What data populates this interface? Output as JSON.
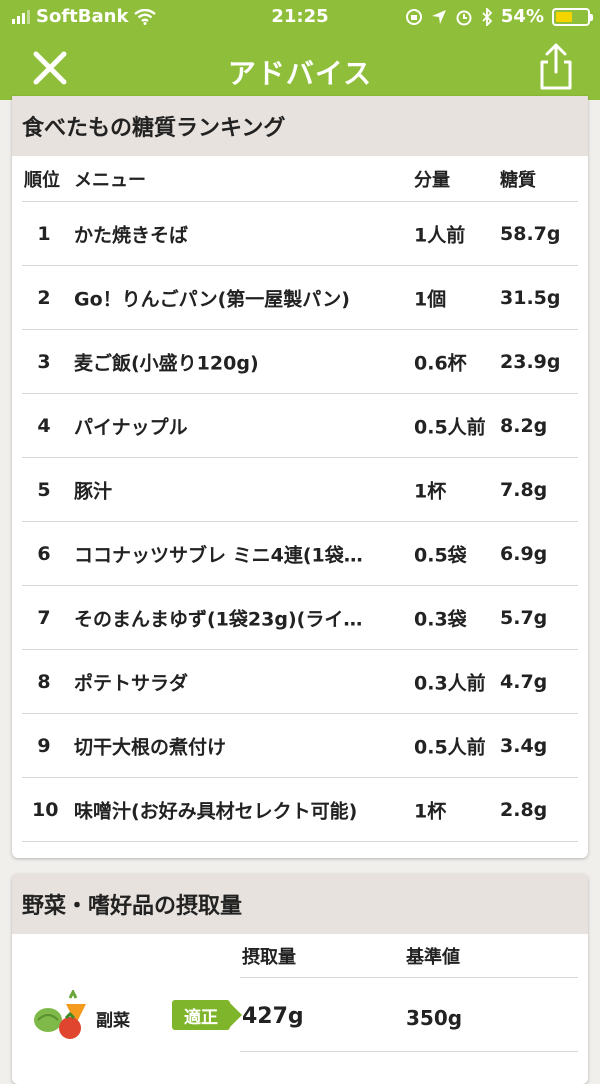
{
  "status_bar": {
    "carrier": "SoftBank",
    "time": "21:25",
    "battery_percent": "54%",
    "battery_level": 0.54,
    "icons": [
      "signal-icon",
      "wifi-icon",
      "orientation-lock-icon",
      "location-icon",
      "alarm-icon",
      "bluetooth-icon",
      "battery-icon"
    ]
  },
  "nav": {
    "title": "アドバイス",
    "close_icon": "close-icon",
    "share_icon": "share-icon"
  },
  "ranking": {
    "title": "食べたもの糖質ランキング",
    "headers": {
      "rank": "順位",
      "menu": "メニュー",
      "quantity": "分量",
      "carbs": "糖質"
    },
    "rows": [
      {
        "rank": "1",
        "menu": "かた焼きそば",
        "quantity": "1人前",
        "carbs": "58.7g"
      },
      {
        "rank": "2",
        "menu": "Go！りんごパン(第一屋製パン)",
        "quantity": "1個",
        "carbs": "31.5g"
      },
      {
        "rank": "3",
        "menu": "麦ご飯(小盛り120g)",
        "quantity": "0.6杯",
        "carbs": "23.9g"
      },
      {
        "rank": "4",
        "menu": "パイナップル",
        "quantity": "0.5人前",
        "carbs": "8.2g"
      },
      {
        "rank": "5",
        "menu": "豚汁",
        "quantity": "1杯",
        "carbs": "7.8g"
      },
      {
        "rank": "6",
        "menu": "ココナッツサブレ ミニ4連(1袋…",
        "quantity": "0.5袋",
        "carbs": "6.9g"
      },
      {
        "rank": "7",
        "menu": "そのまんまゆず(1袋23g)(ライ…",
        "quantity": "0.3袋",
        "carbs": "5.7g"
      },
      {
        "rank": "8",
        "menu": "ポテトサラダ",
        "quantity": "0.3人前",
        "carbs": "4.7g"
      },
      {
        "rank": "9",
        "menu": "切干大根の煮付け",
        "quantity": "0.5人前",
        "carbs": "3.4g"
      },
      {
        "rank": "10",
        "menu": "味噌汁(お好み具材セレクト可能)",
        "quantity": "1杯",
        "carbs": "2.8g"
      }
    ]
  },
  "intake": {
    "title": "野菜・嗜好品の摂取量",
    "headers": {
      "amount": "摂取量",
      "standard": "基準値"
    },
    "rows": [
      {
        "icon": "vegetables-icon",
        "label": "副菜",
        "status": "適正",
        "amount": "427g",
        "standard": "350g"
      }
    ]
  },
  "colors": {
    "accent": "#8fbf3a",
    "badge": "#7fb52b",
    "header_bg": "#e8e2de"
  }
}
